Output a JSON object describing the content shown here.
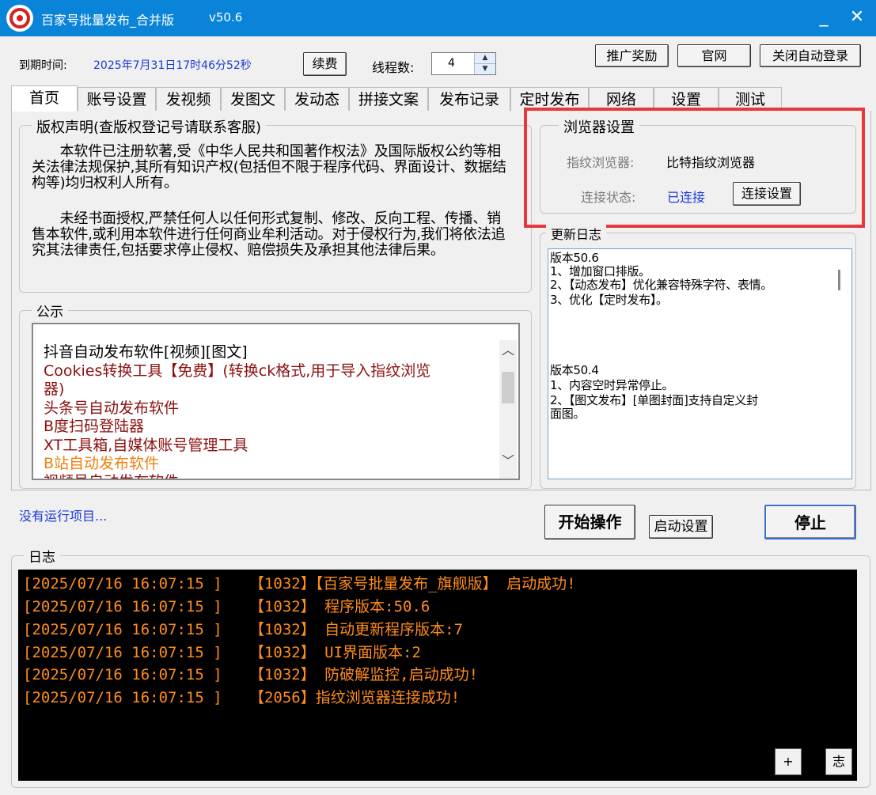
{
  "window": {
    "title": "百家号批量发布_合并版",
    "version": "v50.6",
    "minimize": "_",
    "close": "✕"
  },
  "topbar": {
    "expiry_label": "到期时间:",
    "expiry_value": "2025年7月31日17时46分52秒",
    "renew_button": "续费",
    "threads_label": "线程数:",
    "threads_value": "4",
    "promo_button": "推广奖励",
    "site_button": "官网",
    "autologin_button": "关闭自动登录"
  },
  "tabs": [
    "首页",
    "账号设置",
    "发视频",
    "发图文",
    "发动态",
    "拼接文案",
    "发布记录",
    "定时发布",
    "网络",
    "设置",
    "测试"
  ],
  "copyright": {
    "title": "版权声明(查版权登记号请联系客服)",
    "para1": "　　本软件已注册软著,受《中华人民共和国著作权法》及国际版权公约等相关法律法规保护,其所有知识产权(包括但不限于程序代码、界面设计、数据结构等)均归权利人所有。",
    "para2": "　　未经书面授权,严禁任何人以任何形式复制、修改、反向工程、传播、销售本软件,或利用本软件进行任何商业牟利活动。对于侵权行为,我们将依法追究其法律责任,包括要求停止侵权、赔偿损失及承担其他法律后果。"
  },
  "browser": {
    "title": "浏览器设置",
    "fp_label": "指纹浏览器:",
    "fp_value": "比特指纹浏览器",
    "conn_label": "连接状态:",
    "conn_value": "已连接",
    "conn_button": "连接设置"
  },
  "notice": {
    "title": "公示",
    "items": [
      {
        "text": "抖音自动发布软件[视频][图文]",
        "color": "#000000"
      },
      {
        "text": "Cookies转换工具【免费】(转换ck格式,用于导入指纹浏览",
        "color": "#8b1010"
      },
      {
        "text": "器)",
        "color": "#8b1010"
      },
      {
        "text": "头条号自动发布软件",
        "color": "#8b1010"
      },
      {
        "text": "B度扫码登陆器",
        "color": "#8b1010"
      },
      {
        "text": "XT工具箱,自媒体账号管理工具",
        "color": "#8b1010"
      },
      {
        "text": "B站自动发布软件",
        "color": "#f08010"
      },
      {
        "text": "视频号自动发布软件",
        "color": "#8b1010"
      }
    ]
  },
  "changelog": {
    "title": "更新日志",
    "lines": [
      "版本50.6",
      "1、增加窗口排版。",
      "2、【动态发布】优化兼容特殊字符、表情。",
      "3、优化【定时发布】。",
      "版本50.4",
      "1、内容空时异常停止。",
      "2、【图文发布】[单图封面]支持自定义封",
      "面图。"
    ]
  },
  "status": {
    "idle_text": "没有运行项目...",
    "start_button": "开始操作",
    "startup_settings_button": "启动设置",
    "stop_button": "停止"
  },
  "log": {
    "title": "日志",
    "lines": [
      "[2025/07/16 16:07:15 ]   【1032】【百家号批量发布_旗舰版】 启动成功!",
      "[2025/07/16 16:07:15 ]   【1032】 程序版本:50.6",
      "[2025/07/16 16:07:15 ]   【1032】 自动更新程序版本:7",
      "[2025/07/16 16:07:15 ]   【1032】 UI界面版本:2",
      "[2025/07/16 16:07:15 ]   【1032】 防破解监控,启动成功!",
      "[2025/07/16 16:07:15 ]   【2056】指纹浏览器连接成功!"
    ],
    "plus_button": "+",
    "zhi_button": "志"
  },
  "colors": {
    "titlebar": "#0a84d8",
    "highlight": "#e8383d",
    "log_text": "#ff8c1a",
    "link_blue": "#1a3ad8"
  }
}
